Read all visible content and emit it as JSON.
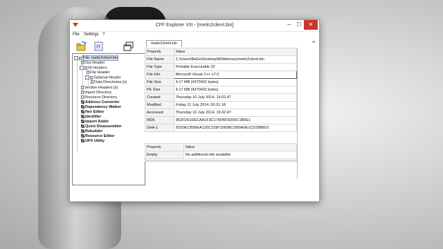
{
  "window": {
    "title": "CFF Explorer VIII - [metin2client.bin]",
    "min_glyph": "─",
    "max_glyph": "☐",
    "close_glyph": "✕",
    "doc_close_glyph": "×"
  },
  "menu": {
    "items": [
      "File",
      "Settings",
      "?"
    ]
  },
  "toolbar": {
    "buttons": [
      "open-icon",
      "hex-icon",
      "windows-icon"
    ]
  },
  "tab": {
    "label": "metin2client.bin"
  },
  "tree": {
    "items": [
      {
        "label": "File: metin2client.bin",
        "selected": true
      },
      {
        "label": "Dos Header"
      },
      {
        "label": "Nt Headers",
        "expander": "−"
      },
      {
        "label": "File Header"
      },
      {
        "label": "Optional Header",
        "expander": "−"
      },
      {
        "label": "Data Directories [x]"
      },
      {
        "label": "Section Headers [x]"
      },
      {
        "label": "Import Directory"
      },
      {
        "label": "Resource Directory"
      },
      {
        "label": "Address Converter",
        "tool": true
      },
      {
        "label": "Dependency Walker",
        "tool": true
      },
      {
        "label": "Hex Editor",
        "tool": true
      },
      {
        "label": "Identifier",
        "tool": true
      },
      {
        "label": "Import Adder",
        "tool": true
      },
      {
        "label": "Quick Disassembler",
        "tool": true
      },
      {
        "label": "Rebuilder",
        "tool": true
      },
      {
        "label": "Resource Editor",
        "tool": true
      },
      {
        "label": "UPX Utility",
        "tool": true
      }
    ]
  },
  "props": {
    "header": {
      "property": "Property",
      "value": "Value"
    },
    "rows": [
      {
        "property": "File Name",
        "value": "C:\\Users\\BaGo\\Desktop\\Mt\\Attorney\\metin2client.bin"
      },
      {
        "property": "File Type",
        "value": "Portable Executable 32"
      },
      {
        "property": "File Info",
        "value": "Microsoft Visual C++ v7.0",
        "focus": true
      },
      {
        "property": "File Size",
        "value": "4.17 MB (4370432 bytes)"
      },
      {
        "property": "PE Size",
        "value": "4.17 MB (4370432 bytes)"
      },
      {
        "property": "Created",
        "value": "Thursday 10 July 2014, 19.02.47"
      },
      {
        "property": "Modified",
        "value": "Friday 11 July 2014, 00.31.18"
      },
      {
        "property": "Accessed",
        "value": "Thursday 10 July 2014, 19.02.47"
      },
      {
        "property": "MD5",
        "value": "952FD51DECAA1F3C175FBF5D05C1B0E1"
      },
      {
        "property": "SHA-1",
        "value": "5D20ECB58EA125C233F1583BCDB9A0E1CD39B810"
      }
    ]
  },
  "extra": {
    "header": {
      "property": "Property",
      "value": "Value"
    },
    "rows": [
      {
        "property": "Empty",
        "value": "No additional info available"
      }
    ]
  }
}
